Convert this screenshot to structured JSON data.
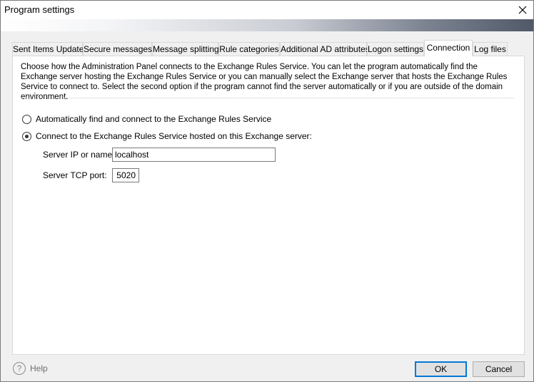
{
  "window": {
    "title": "Program settings"
  },
  "tabs": [
    {
      "label": "Sent Items Update",
      "active": false
    },
    {
      "label": "Secure messages",
      "active": false
    },
    {
      "label": "Message splitting",
      "active": false
    },
    {
      "label": "Rule categories",
      "active": false
    },
    {
      "label": "Additional AD attributes",
      "active": false
    },
    {
      "label": "Logon settings",
      "active": false
    },
    {
      "label": "Connection",
      "active": true
    },
    {
      "label": "Log files",
      "active": false
    }
  ],
  "connection": {
    "description": "Choose how the Administration Panel connects to the Exchange Rules Service. You can let the program automatically find the Exchange server hosting the Exchange Rules Service or you can manually select the Exchange server that hosts the Exchange Rules Service to connect to. Select the second option if the program cannot find the server automatically or if you are outside of the domain environment.",
    "options": [
      {
        "label": "Automatically find and connect to the Exchange Rules Service",
        "checked": false
      },
      {
        "label": "Connect to the Exchange Rules Service hosted on this Exchange server:",
        "checked": true
      }
    ],
    "server_ip_label": "Server IP or name:",
    "server_ip_value": "localhost",
    "tcp_port_label": "Server TCP port:",
    "tcp_port_value": "5020"
  },
  "footer": {
    "help_icon": "?",
    "help_label": "Help",
    "ok_label": "OK",
    "cancel_label": "Cancel"
  },
  "icons": {
    "close": "close-icon",
    "help": "help-circle-icon"
  },
  "colors": {
    "default_button_border": "#0078d7",
    "panel_background": "#ffffff",
    "window_background": "#f0f0f0"
  }
}
